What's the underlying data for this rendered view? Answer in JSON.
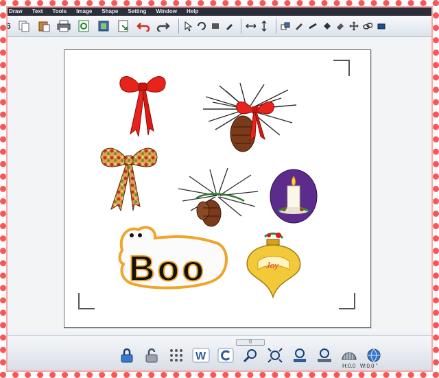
{
  "menu": [
    "Draw",
    "Text",
    "Tools",
    "Image",
    "Shape",
    "Setting",
    "Window",
    "Help"
  ],
  "toolbar": {
    "number_label": "6"
  },
  "canvas": {
    "clips": [
      {
        "name": "red-bow"
      },
      {
        "name": "pine-cone-bow"
      },
      {
        "name": "floral-bow"
      },
      {
        "name": "pine-sprig"
      },
      {
        "name": "candle-oval"
      },
      {
        "name": "boo-ghost",
        "text": "Boo"
      },
      {
        "name": "joy-ornament",
        "text": "Joy"
      }
    ]
  },
  "bottom": {
    "grip_label": "|||",
    "status": {
      "h": "H:0.0",
      "w": "W:0.0 \""
    }
  }
}
